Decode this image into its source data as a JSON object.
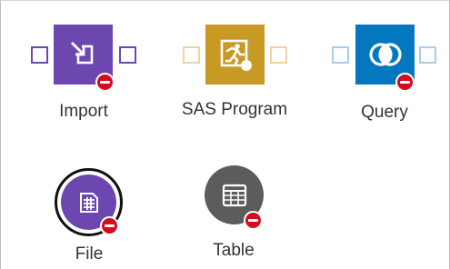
{
  "nodes": {
    "import": {
      "label": "Import",
      "icon": "import-arrow-icon",
      "color": "#6d47b0"
    },
    "sas_program": {
      "label": "SAS Program",
      "icon": "sas-program-runner-icon",
      "color": "#c89a25"
    },
    "query": {
      "label": "Query",
      "icon": "query-join-icon",
      "color": "#0478be"
    },
    "file": {
      "label": "File",
      "icon": "file-grid-icon",
      "color": "#6d47b0"
    },
    "table": {
      "label": "Table",
      "icon": "table-grid-icon",
      "color": "#5c5c5c"
    }
  },
  "colors": {
    "badge": "#d00e1f",
    "import_port": "#6d47b0",
    "sas_port": "#f0d3a0",
    "query_port": "#a9cdec"
  }
}
